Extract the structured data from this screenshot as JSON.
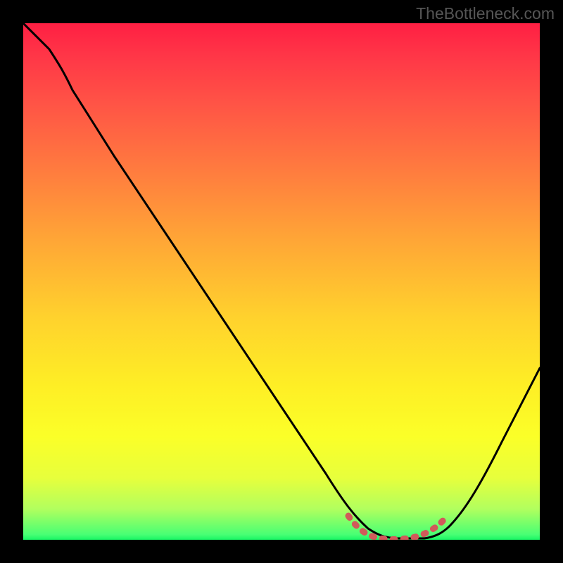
{
  "watermark": "TheBottleneck.com",
  "chart_data": {
    "type": "line",
    "title": "",
    "xlabel": "",
    "ylabel": "",
    "xlim": [
      0,
      100
    ],
    "ylim": [
      0,
      100
    ],
    "grid": false,
    "legend": false,
    "background": "rainbow-vertical-gradient",
    "series": [
      {
        "name": "main-curve",
        "color": "#000000",
        "x": [
          0,
          5,
          8,
          12,
          20,
          30,
          40,
          50,
          58,
          62,
          66,
          70,
          74,
          78,
          80,
          84,
          90,
          95,
          100
        ],
        "values": [
          100,
          95,
          91,
          86,
          74,
          60,
          45,
          30,
          18,
          10,
          4,
          1,
          0,
          0,
          1,
          4,
          14,
          28,
          45
        ]
      },
      {
        "name": "minimum-highlight",
        "color": "#d15a5a",
        "x": [
          62,
          65,
          68,
          71,
          74,
          77,
          80
        ],
        "values": [
          4.5,
          2,
          0.8,
          0.2,
          0.2,
          0.8,
          2.5
        ]
      }
    ],
    "colors": {
      "page_background": "#000000",
      "gradient_top": "#ff1f43",
      "gradient_bottom": "#18f664",
      "curve": "#000000",
      "highlight": "#d15a5a",
      "watermark": "#565656"
    }
  }
}
